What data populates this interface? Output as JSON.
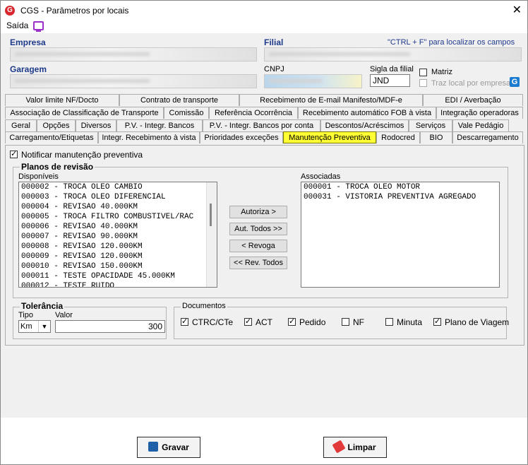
{
  "window": {
    "title": "CGS - Parâmetros por locais",
    "close": "✕",
    "logo": "G"
  },
  "menu": {
    "saida": "Saída",
    "monitor_icon": "monitor-icon"
  },
  "header": {
    "empresa_label": "Empresa",
    "filial_label": "Filial",
    "ctrl_tip": "\"CTRL + F\" para localizar os campos",
    "garagem_label": "Garagem",
    "cnpj_label": "CNPJ",
    "sigla_label": "Sigla da filial",
    "sigla_value": "JND",
    "matriz_label": "Matriz",
    "traz_local_label": "Traz local por empresa",
    "g_icon": "G"
  },
  "tabs": {
    "row1": [
      "Valor limite NF/Docto",
      "Contrato de transporte",
      "Recebimento de E-mail Manifesto/MDF-e",
      "EDI / Averbação"
    ],
    "row2": [
      "Associação de Classificação de Transporte",
      "Comissão",
      "Referência Ocorrência",
      "Recebimento automático FOB à vista",
      "Integração operadoras"
    ],
    "row3": [
      "Geral",
      "Opções",
      "Diversos",
      "P.V. - Integr. Bancos",
      "P.V. - Integr. Bancos por conta",
      "Descontos/Acréscimos",
      "Serviços",
      "Vale Pedágio"
    ],
    "row4": [
      "Carregamento/Etiquetas",
      "Integr. Recebimento à vista",
      "Prioridades exceções",
      "Manutenção Preventiva",
      "Rodocred",
      "BIO",
      "Descarregamento"
    ]
  },
  "panel": {
    "notificar_label": "Notificar manutenção preventiva",
    "notificar_checked": true,
    "planos_title": "Planos de revisão",
    "disponiveis_label": "Disponíveis",
    "associadas_label": "Associadas",
    "disponiveis": [
      "000002 - TROCA OLEO CAMBIO",
      "000003 - TROCA OLEO DIFERENCIAL",
      "000004 - REVISAO 40.000KM",
      "000005 - TROCA FILTRO COMBUSTIVEL/RAC",
      "000006 - REVISAO 40.000KM",
      "000007 - REVISAO 90.000KM",
      "000008 - REVISAO 120.000KM",
      "000009 - REVISAO 120.000KM",
      "000010 - REVISAO 150.000KM",
      "000011 - TESTE OPACIDADE 45.000KM",
      "000012 - TESTE RUIDO"
    ],
    "associadas": [
      "000001 - TROCA OLEO MOTOR",
      "000031 - VISTORIA PREVENTIVA AGREGADO"
    ],
    "btn_autoriza": "Autoriza >",
    "btn_aut_todos": "Aut. Todos >>",
    "btn_revoga": "< Revoga",
    "btn_rev_todos": "<< Rev. Todos",
    "tolerancia_title": "Tolerância",
    "tipo_label": "Tipo",
    "tipo_value": "Km",
    "valor_label": "Valor",
    "valor_value": "300",
    "documentos_title": "Documentos",
    "documentos": [
      {
        "label": "CTRC/CTe",
        "checked": true
      },
      {
        "label": "ACT",
        "checked": true
      },
      {
        "label": "Pedido",
        "checked": true
      },
      {
        "label": "NF",
        "checked": false
      },
      {
        "label": "Minuta",
        "checked": false
      },
      {
        "label": "Plano de Viagem",
        "checked": true
      }
    ]
  },
  "footer": {
    "gravar": "Gravar",
    "limpar": "Limpar"
  }
}
